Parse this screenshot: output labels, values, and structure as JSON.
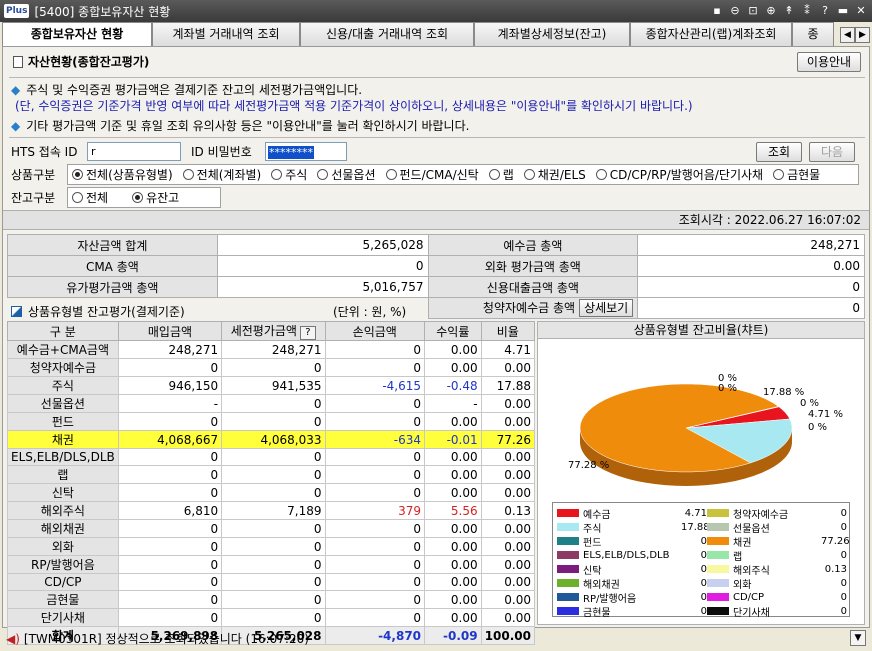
{
  "window": {
    "logo": "Plus",
    "title": "[5400] 종합보유자산 현황",
    "controls": [
      "▪",
      "⊖",
      "⊡",
      "⊕",
      "↟",
      "⁑",
      "?",
      "▬",
      "✕"
    ]
  },
  "tabs": [
    "종합보유자산 현황",
    "계좌별 거래내역 조회",
    "신용/대출 거래내역 조회",
    "계좌별상세정보(잔고)",
    "종합자산관리(랩)계좌조회",
    "종"
  ],
  "section": {
    "title": "자산현황(종합잔고평가)",
    "info_button": "이용안내"
  },
  "notices": [
    "주식 및 수익증권 평가금액은 결제기준 잔고의 세전평가금액입니다.",
    "(단, 수익증권은 기준가격 반영 여부에 따라 세전평가금액 적용 기준가격이 상이하오니, 상세내용은 \"이용안내\"를 확인하시기 바랍니다.)",
    "기타 평가금액 기준 및 휴일 조회 유의사항 등은 \"이용안내\"를 눌러 확인하시기 바랍니다."
  ],
  "form": {
    "hts_label": "HTS 접속 ID",
    "hts_value": "r",
    "pw_label": "ID 비밀번호",
    "pw_value": "********",
    "query": "조회",
    "next": "다음",
    "product_label": "상품구분",
    "product_options": [
      "전체(상품유형별)",
      "전체(계좌별)",
      "주식",
      "선물옵션",
      "펀드/CMA/신탁",
      "랩",
      "채권/ELS",
      "CD/CP/RP/발행어음/단기사채",
      "금현물"
    ],
    "balance_label": "잔고구분",
    "balance_options": [
      "전체",
      "유잔고"
    ]
  },
  "query_time": "조회시각 : 2022.06.27 16:07:02",
  "summary": [
    [
      "자산금액 합계",
      "5,265,028",
      "예수금 총액",
      "248,271"
    ],
    [
      "CMA 총액",
      "0",
      "외화 평가금액 총액",
      "0.00"
    ],
    [
      "유가평가금액 총액",
      "5,016,757",
      "신용대출금액 총액",
      "0"
    ],
    [
      "",
      "",
      "청약자예수금 총액",
      "0"
    ]
  ],
  "detail_button": "상세보기",
  "sub_title": "상품유형별 잔고평가(결제기준)",
  "unit": "(단위 : 원, %)",
  "columns": [
    "구 분",
    "매입금액",
    "세전평가금액",
    "손익금액",
    "수익률",
    "비율"
  ],
  "rows": [
    [
      "예수금+CMA금액",
      "248,271",
      "248,271",
      "0",
      "0.00",
      "4.71"
    ],
    [
      "청약자예수금",
      "0",
      "0",
      "0",
      "0.00",
      "0.00"
    ],
    [
      "주식",
      "946,150",
      "941,535",
      "-4,615",
      "-0.48",
      "17.88"
    ],
    [
      "선물옵션",
      "-",
      "0",
      "0",
      "-",
      "0.00"
    ],
    [
      "펀드",
      "0",
      "0",
      "0",
      "0.00",
      "0.00"
    ],
    [
      "채권",
      "4,068,667",
      "4,068,033",
      "-634",
      "-0.01",
      "77.26"
    ],
    [
      "ELS,ELB/DLS,DLB",
      "0",
      "0",
      "0",
      "0.00",
      "0.00"
    ],
    [
      "랩",
      "0",
      "0",
      "0",
      "0.00",
      "0.00"
    ],
    [
      "신탁",
      "0",
      "0",
      "0",
      "0.00",
      "0.00"
    ],
    [
      "해외주식",
      "6,810",
      "7,189",
      "379",
      "5.56",
      "0.13"
    ],
    [
      "해외채권",
      "0",
      "0",
      "0",
      "0.00",
      "0.00"
    ],
    [
      "외화",
      "0",
      "0",
      "0",
      "0.00",
      "0.00"
    ],
    [
      "RP/발행어음",
      "0",
      "0",
      "0",
      "0.00",
      "0.00"
    ],
    [
      "CD/CP",
      "0",
      "0",
      "0",
      "0.00",
      "0.00"
    ],
    [
      "금현물",
      "0",
      "0",
      "0",
      "0.00",
      "0.00"
    ],
    [
      "단기사채",
      "0",
      "0",
      "0",
      "0.00",
      "0.00"
    ]
  ],
  "total": [
    "합계",
    "5,269,898",
    "5,265,028",
    "-4,870",
    "-0.09",
    "100.00"
  ],
  "chart_data": {
    "type": "pie",
    "title": "상품유형별 잔고비율(챠트)",
    "labels": [
      "예수금",
      "청약자예수금",
      "주식",
      "선물옵션",
      "펀드",
      "채권",
      "ELS,ELB/DLS,DLB",
      "랩",
      "신탁",
      "해외주식",
      "해외채권",
      "외화",
      "RP/발행어음",
      "CD/CP",
      "금현물",
      "단기사채"
    ],
    "values": [
      4.71,
      0,
      17.88,
      0,
      0,
      77.26,
      0,
      0,
      0,
      0.13,
      0,
      0,
      0,
      0,
      0,
      0
    ],
    "value_labels": [
      "4.71",
      "0",
      "17.88",
      "0",
      "0",
      "77.26",
      "0",
      "0",
      "0",
      "0.13",
      "0",
      "0",
      "0",
      "0",
      "0",
      "0"
    ],
    "colors": [
      "#e8141e",
      "#c8c23c",
      "#a8e8f0",
      "#b8c8b0",
      "#208088",
      "#f08c0c",
      "#8c3c64",
      "#98e6a8",
      "#7c1c7c",
      "#f8f8a0",
      "#6cb02c",
      "#c8d0f0",
      "#205898",
      "#e01ce0",
      "#2c2ce0",
      "#0c0c0c"
    ],
    "pie_labels": [
      {
        "text": "17.88 %"
      },
      {
        "text": "77.28 %"
      },
      {
        "text": "0 %"
      },
      {
        "text": "0 %"
      },
      {
        "text": "0 %"
      },
      {
        "text": "4.71 %"
      },
      {
        "text": "0 %"
      }
    ]
  },
  "status": "[TWM0301R] 정상적으로 조회되었습니다 (16:07:20)"
}
